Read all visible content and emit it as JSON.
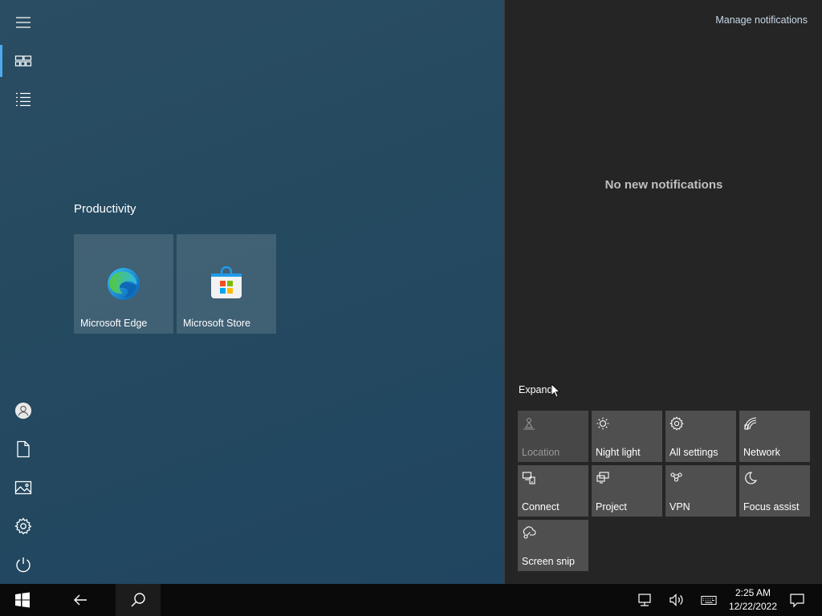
{
  "start_menu": {
    "group_title": "Productivity",
    "tiles": [
      {
        "label": "Microsoft Edge",
        "icon": "edge-icon"
      },
      {
        "label": "Microsoft Store",
        "icon": "store-icon"
      }
    ],
    "rail_icons": [
      "hamburger-menu-icon",
      "pinned-tiles-icon",
      "all-apps-list-icon",
      "user-account-icon",
      "documents-icon",
      "pictures-icon",
      "settings-gear-icon",
      "power-icon"
    ]
  },
  "action_center": {
    "manage_notifications": "Manage notifications",
    "empty_message": "No new notifications",
    "expand_label": "Expand",
    "quick_actions": [
      {
        "label": "Location",
        "icon": "location-icon",
        "enabled": false
      },
      {
        "label": "Night light",
        "icon": "night-light-icon",
        "enabled": true
      },
      {
        "label": "All settings",
        "icon": "settings-gear-icon",
        "enabled": true
      },
      {
        "label": "Network",
        "icon": "network-icon",
        "enabled": true
      },
      {
        "label": "Connect",
        "icon": "connect-icon",
        "enabled": true
      },
      {
        "label": "Project",
        "icon": "project-icon",
        "enabled": true
      },
      {
        "label": "VPN",
        "icon": "vpn-icon",
        "enabled": true
      },
      {
        "label": "Focus assist",
        "icon": "moon-icon",
        "enabled": true
      },
      {
        "label": "Screen snip",
        "icon": "screen-snip-icon",
        "enabled": true
      }
    ]
  },
  "taskbar": {
    "time": "2:25 AM",
    "date": "12/22/2022",
    "icons": [
      "windows-start-icon",
      "back-arrow-icon",
      "search-icon",
      "network-tray-icon",
      "volume-icon",
      "touch-keyboard-icon",
      "notification-center-icon"
    ]
  },
  "colors": {
    "accent": "#4ea8f0",
    "action_center_bg": "#252525",
    "quick_action_tile": "#4f4f4f",
    "taskbar_bg": "#0a0a0a"
  }
}
